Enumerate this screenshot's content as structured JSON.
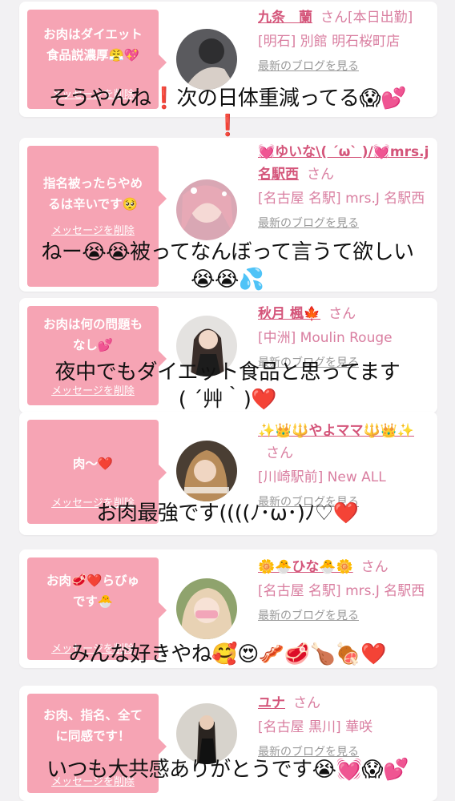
{
  "cards": [
    {
      "bubble": "お肉はダイエット\n食品説濃厚😤💖",
      "delete": "メッセージを削除",
      "name": "九条　蘭",
      "name_suffix": "さん[本日出勤]",
      "shop": "[明石] 別館 明石桜町店",
      "blog": "最新のブログを見る"
    },
    {
      "bubble": "指名被ったらやめ\nるは辛いです🥺",
      "delete": "メッセージを削除",
      "name": "💓ゆいな\\( ´ω` )/💓mrs.j名駅西",
      "name_suffix": "さん",
      "shop": "[名古屋 名駅] mrs.J 名駅西",
      "blog": "最新のブログを見る"
    },
    {
      "bubble": "お肉は何の問題も\nなし💕",
      "delete": "メッセージを削除",
      "name": "秋月 楓🍁",
      "name_suffix": "さん",
      "shop": "[中洲] Moulin Rouge",
      "blog": "最新のブログを見る"
    },
    {
      "bubble": "肉〜❤️",
      "delete": "メッセージを削除",
      "name": "✨👑🔱やよママ🔱👑✨",
      "name_suffix": "さん",
      "shop": "[川崎駅前] New ALL",
      "blog": "最新のブログを見る"
    },
    {
      "bubble": "お肉🥩❤️らびゅ\nです🐣",
      "delete": "メッセージを削除",
      "name": "🌼🐣ひな🐣🌼",
      "name_suffix": "さん",
      "shop": "[名古屋 名駅] mrs.J 名駅西",
      "blog": "最新のブログを見る"
    },
    {
      "bubble": "お肉、指名、全て\nに同感です！",
      "delete": "メッセージを削除",
      "name": "ユナ",
      "name_suffix": "さん",
      "shop": "[名古屋 黒川] 華咲",
      "blog": "最新のブログを見る"
    }
  ],
  "captions": [
    "そうやんね❗️次の日体重減ってる😱💕\n❗️",
    "ねー😭😭被ってなんぼって言うて欲しい\n😭😭💦",
    "夜中でもダイエット食品と思ってます\n( ´艸｀)❤️",
    "お肉最強です((((ﾉ･ω･)ﾉ♡❤️",
    "みんな好きやね🥰😍🥓🥩🍗🍖❤️",
    "いつも大共感ありがとうです😭💓😱💕"
  ],
  "colors": {
    "bubble": "#f6a4b4",
    "name": "#d4557a",
    "background": "#f2f1f3"
  }
}
